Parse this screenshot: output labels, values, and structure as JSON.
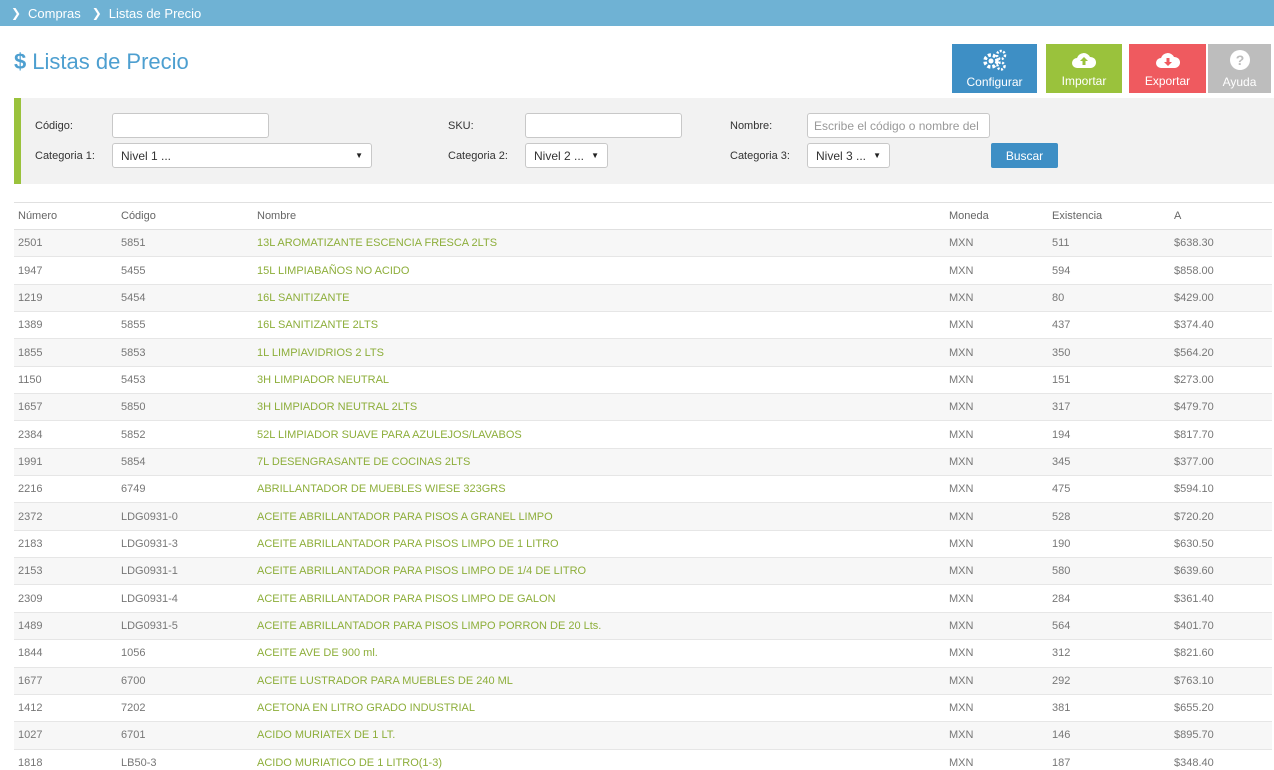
{
  "breadcrumb": {
    "items": [
      "Compras",
      "Listas de Precio"
    ]
  },
  "page": {
    "title": "Listas de Precio",
    "title_icon": "dollar-icon"
  },
  "toolbar": {
    "configurar": {
      "label": "Configurar",
      "icon": "gears-icon",
      "color": "#3e8fc5"
    },
    "importar": {
      "label": "Importar",
      "icon": "cloud-upload-icon",
      "color": "#9ac23c"
    },
    "exportar": {
      "label": "Exportar",
      "icon": "cloud-download-icon",
      "color": "#ef5a5f"
    },
    "ayuda": {
      "label": "Ayuda",
      "icon": "question-icon",
      "color": "#bdbdbd"
    }
  },
  "filters": {
    "codigo_label": "Código:",
    "sku_label": "SKU:",
    "nombre_label": "Nombre:",
    "nombre_placeholder": "Escribe el código o nombre del",
    "cat1_label": "Categoria 1:",
    "cat1_value": "Nivel 1 ...",
    "cat2_label": "Categoria 2:",
    "cat2_value": "Nivel 2 ...",
    "cat3_label": "Categoria 3:",
    "cat3_value": "Nivel 3 ...",
    "buscar_label": "Buscar"
  },
  "table": {
    "columns": [
      "Número",
      "Código",
      "Nombre",
      "Moneda",
      "Existencia",
      "A"
    ],
    "rows": [
      [
        "2501",
        "5851",
        "13L AROMATIZANTE ESCENCIA FRESCA 2LTS",
        "MXN",
        "511",
        "$638.30"
      ],
      [
        "1947",
        "5455",
        "15L LIMPIABAÑOS NO ACIDO",
        "MXN",
        "594",
        "$858.00"
      ],
      [
        "1219",
        "5454",
        "16L SANITIZANTE",
        "MXN",
        "80",
        "$429.00"
      ],
      [
        "1389",
        "5855",
        "16L SANITIZANTE 2LTS",
        "MXN",
        "437",
        "$374.40"
      ],
      [
        "1855",
        "5853",
        "1L LIMPIAVIDRIOS 2 LTS",
        "MXN",
        "350",
        "$564.20"
      ],
      [
        "1150",
        "5453",
        "3H LIMPIADOR NEUTRAL",
        "MXN",
        "151",
        "$273.00"
      ],
      [
        "1657",
        "5850",
        "3H LIMPIADOR NEUTRAL 2LTS",
        "MXN",
        "317",
        "$479.70"
      ],
      [
        "2384",
        "5852",
        "52L LIMPIADOR SUAVE PARA AZULEJOS/LAVABOS",
        "MXN",
        "194",
        "$817.70"
      ],
      [
        "1991",
        "5854",
        "7L DESENGRASANTE DE COCINAS 2LTS",
        "MXN",
        "345",
        "$377.00"
      ],
      [
        "2216",
        "6749",
        "ABRILLANTADOR DE MUEBLES WIESE 323GRS",
        "MXN",
        "475",
        "$594.10"
      ],
      [
        "2372",
        "LDG0931-0",
        "ACEITE ABRILLANTADOR PARA PISOS A GRANEL LIMPO",
        "MXN",
        "528",
        "$720.20"
      ],
      [
        "2183",
        "LDG0931-3",
        "ACEITE ABRILLANTADOR PARA PISOS LIMPO DE 1 LITRO",
        "MXN",
        "190",
        "$630.50"
      ],
      [
        "2153",
        "LDG0931-1",
        "ACEITE ABRILLANTADOR PARA PISOS LIMPO DE 1/4 DE LITRO",
        "MXN",
        "580",
        "$639.60"
      ],
      [
        "2309",
        "LDG0931-4",
        "ACEITE ABRILLANTADOR PARA PISOS LIMPO DE GALON",
        "MXN",
        "284",
        "$361.40"
      ],
      [
        "1489",
        "LDG0931-5",
        "ACEITE ABRILLANTADOR PARA PISOS LIMPO PORRON DE 20 Lts.",
        "MXN",
        "564",
        "$401.70"
      ],
      [
        "1844",
        "1056",
        "ACEITE AVE DE 900 ml.",
        "MXN",
        "312",
        "$821.60"
      ],
      [
        "1677",
        "6700",
        "ACEITE LUSTRADOR PARA MUEBLES DE 240 ML",
        "MXN",
        "292",
        "$763.10"
      ],
      [
        "1412",
        "7202",
        "ACETONA EN LITRO GRADO INDUSTRIAL",
        "MXN",
        "381",
        "$655.20"
      ],
      [
        "1027",
        "6701",
        "ACIDO MURIATEX DE 1 LT.",
        "MXN",
        "146",
        "$895.70"
      ],
      [
        "1818",
        "LB50-3",
        "ACIDO MURIATICO DE 1 LITRO(1-3)",
        "MXN",
        "187",
        "$348.40"
      ]
    ]
  }
}
